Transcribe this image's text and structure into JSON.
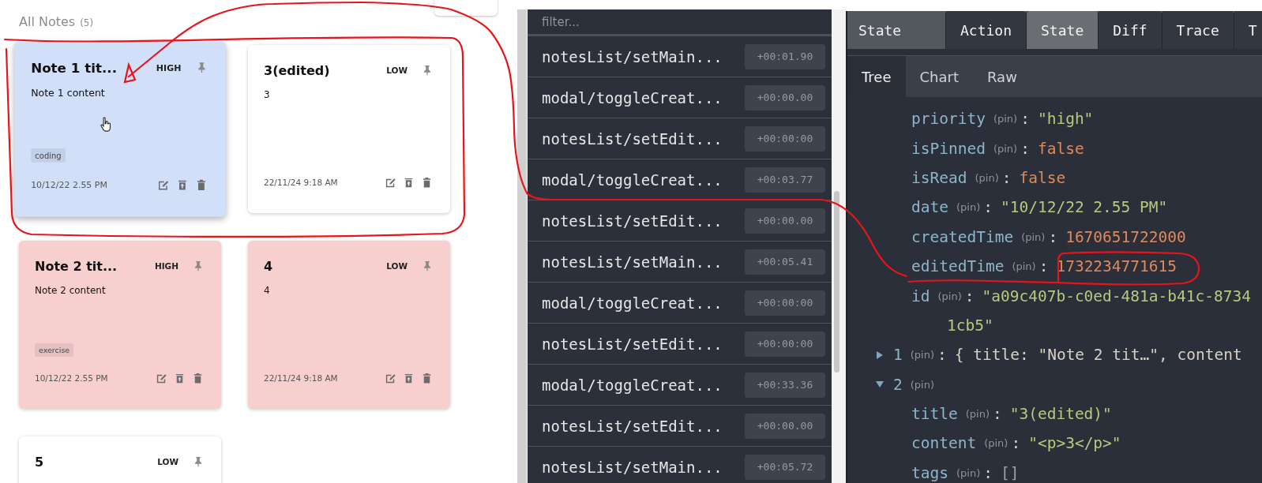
{
  "notes_panel": {
    "heading": "All Notes",
    "count": "(5)",
    "notes": [
      {
        "title": "Note 1 tit...",
        "priority": "HIGH",
        "content": "Note 1 content",
        "tags": [
          "coding"
        ],
        "date": "10/12/22 2.55 PM",
        "color": "#d1dff8",
        "hovered": true
      },
      {
        "title": "3(edited)",
        "priority": "LOW",
        "content": "3",
        "date": "22/11/24 9:18 AM",
        "color": "#ffffff",
        "hovered": false
      },
      {
        "title": "Note 2 tit...",
        "priority": "HIGH",
        "content": "Note 2 content",
        "tags": [
          "exercise"
        ],
        "date": "10/12/22 2.55 PM",
        "color": "#f7cfcf",
        "hovered": false
      },
      {
        "title": "4",
        "priority": "LOW",
        "content": "4",
        "date": "22/11/24 9:18 AM",
        "color": "#f7cfcf",
        "hovered": false
      },
      {
        "title": "5",
        "priority": "LOW",
        "color": "#ffffff",
        "hovered": false
      }
    ]
  },
  "action_list": {
    "filter_placeholder": "filter...",
    "actions": [
      {
        "name": "notesList/setMain...",
        "time": "+00:01.90"
      },
      {
        "name": "modal/toggleCreat...",
        "time": "+00:00.00"
      },
      {
        "name": "notesList/setEdit...",
        "time": "+00:00:00"
      },
      {
        "name": "modal/toggleCreat...",
        "time": "+00:03.77"
      },
      {
        "name": "notesList/setEdit...",
        "time": "+00:00.00"
      },
      {
        "name": "notesList/setMain...",
        "time": "+00:05.41"
      },
      {
        "name": "modal/toggleCreat...",
        "time": "+00:00:00"
      },
      {
        "name": "notesList/setEdit...",
        "time": "+00:00:00"
      },
      {
        "name": "modal/toggleCreat...",
        "time": "+00:33.36"
      },
      {
        "name": "notesList/setEdit...",
        "time": "+00:00.00"
      },
      {
        "name": "notesList/setMain...",
        "time": "+00:05.72"
      }
    ]
  },
  "inspector": {
    "title": "State",
    "tabs": [
      {
        "label": "Action",
        "selected": false
      },
      {
        "label": "State",
        "selected": true
      },
      {
        "label": "Diff",
        "selected": false
      },
      {
        "label": "Trace",
        "selected": false
      },
      {
        "label": "T",
        "selected": false
      }
    ],
    "subtabs": [
      {
        "label": "Tree",
        "selected": true
      },
      {
        "label": "Chart",
        "selected": false
      },
      {
        "label": "Raw",
        "selected": false
      }
    ],
    "tree": [
      {
        "children": [
          {
            "key": "priority",
            "badge": "(pin)",
            "sep": ":",
            "kind": "string",
            "value": "\"high\""
          },
          {
            "key": "isPinned",
            "badge": "(pin)",
            "sep": ":",
            "kind": "boolean",
            "value": "false"
          },
          {
            "key": "isRead",
            "badge": "(pin)",
            "sep": ":",
            "kind": "boolean",
            "value": "false"
          },
          {
            "key": "date",
            "badge": "(pin)",
            "sep": ":",
            "kind": "string",
            "value": "\"10/12/22 2.55 PM\""
          },
          {
            "key": "createdTime",
            "badge": "(pin)",
            "sep": ":",
            "kind": "number",
            "value": "1670651722000"
          },
          {
            "key": "editedTime",
            "badge": "(pin)",
            "sep": ":",
            "kind": "number",
            "value": "1732234771615"
          },
          {
            "key": "id",
            "badge": "(pin)",
            "sep": ":",
            "kind": "string",
            "value": "\"a09c407b-c0ed-481a-b41c-8734",
            "continuation": "1cb5\""
          }
        ]
      },
      {
        "key": "1",
        "badge": "(pin)",
        "sep": ":",
        "expanded": false,
        "summary": "{ title: \"Note 2 tit…\", content"
      },
      {
        "key": "2",
        "badge": "(pin)",
        "expanded": true,
        "children": [
          {
            "key": "title",
            "badge": "(pin)",
            "sep": ":",
            "kind": "string",
            "value": "\"3(edited)\""
          },
          {
            "key": "content",
            "badge": "(pin)",
            "sep": ":",
            "kind": "string",
            "value": "\"<p>3</p>\""
          },
          {
            "key": "tags",
            "badge": "(pin)",
            "sep": ":",
            "kind": "array",
            "value": "[]"
          }
        ]
      }
    ]
  }
}
